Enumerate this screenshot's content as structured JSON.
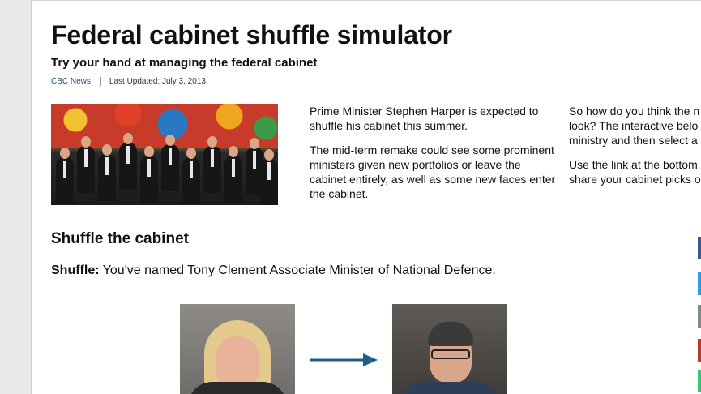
{
  "page": {
    "title": "Federal cabinet shuffle simulator",
    "deck": "Try your hand at managing the federal cabinet",
    "source": "CBC News",
    "updated": "Last Updated: July 3, 2013"
  },
  "intro": {
    "col1_p1": "Prime Minister Stephen Harper is expected to shuffle his cabinet this summer.",
    "col1_p2": "The mid-term remake could see some prominent ministers given new portfolios or leave the cabinet entirely, as well as some new faces enter the cabinet.",
    "col2_line1": "So how do you think the n",
    "col2_line2": "look? The interactive belo",
    "col2_line3": "ministry and then select a",
    "col2_line4": "Use the link at the bottom",
    "col2_line5": "share your cabinet picks o"
  },
  "shuffle": {
    "section_title": "Shuffle the cabinet",
    "label": "Shuffle:",
    "message": " You've named Tony Clement Associate Minister of National Defence."
  },
  "colors": {
    "accent": "#1f5e86",
    "share": [
      "#3b5998",
      "#1da1f2",
      "#7f8c8d",
      "#c0392b",
      "#2ecc71"
    ]
  }
}
